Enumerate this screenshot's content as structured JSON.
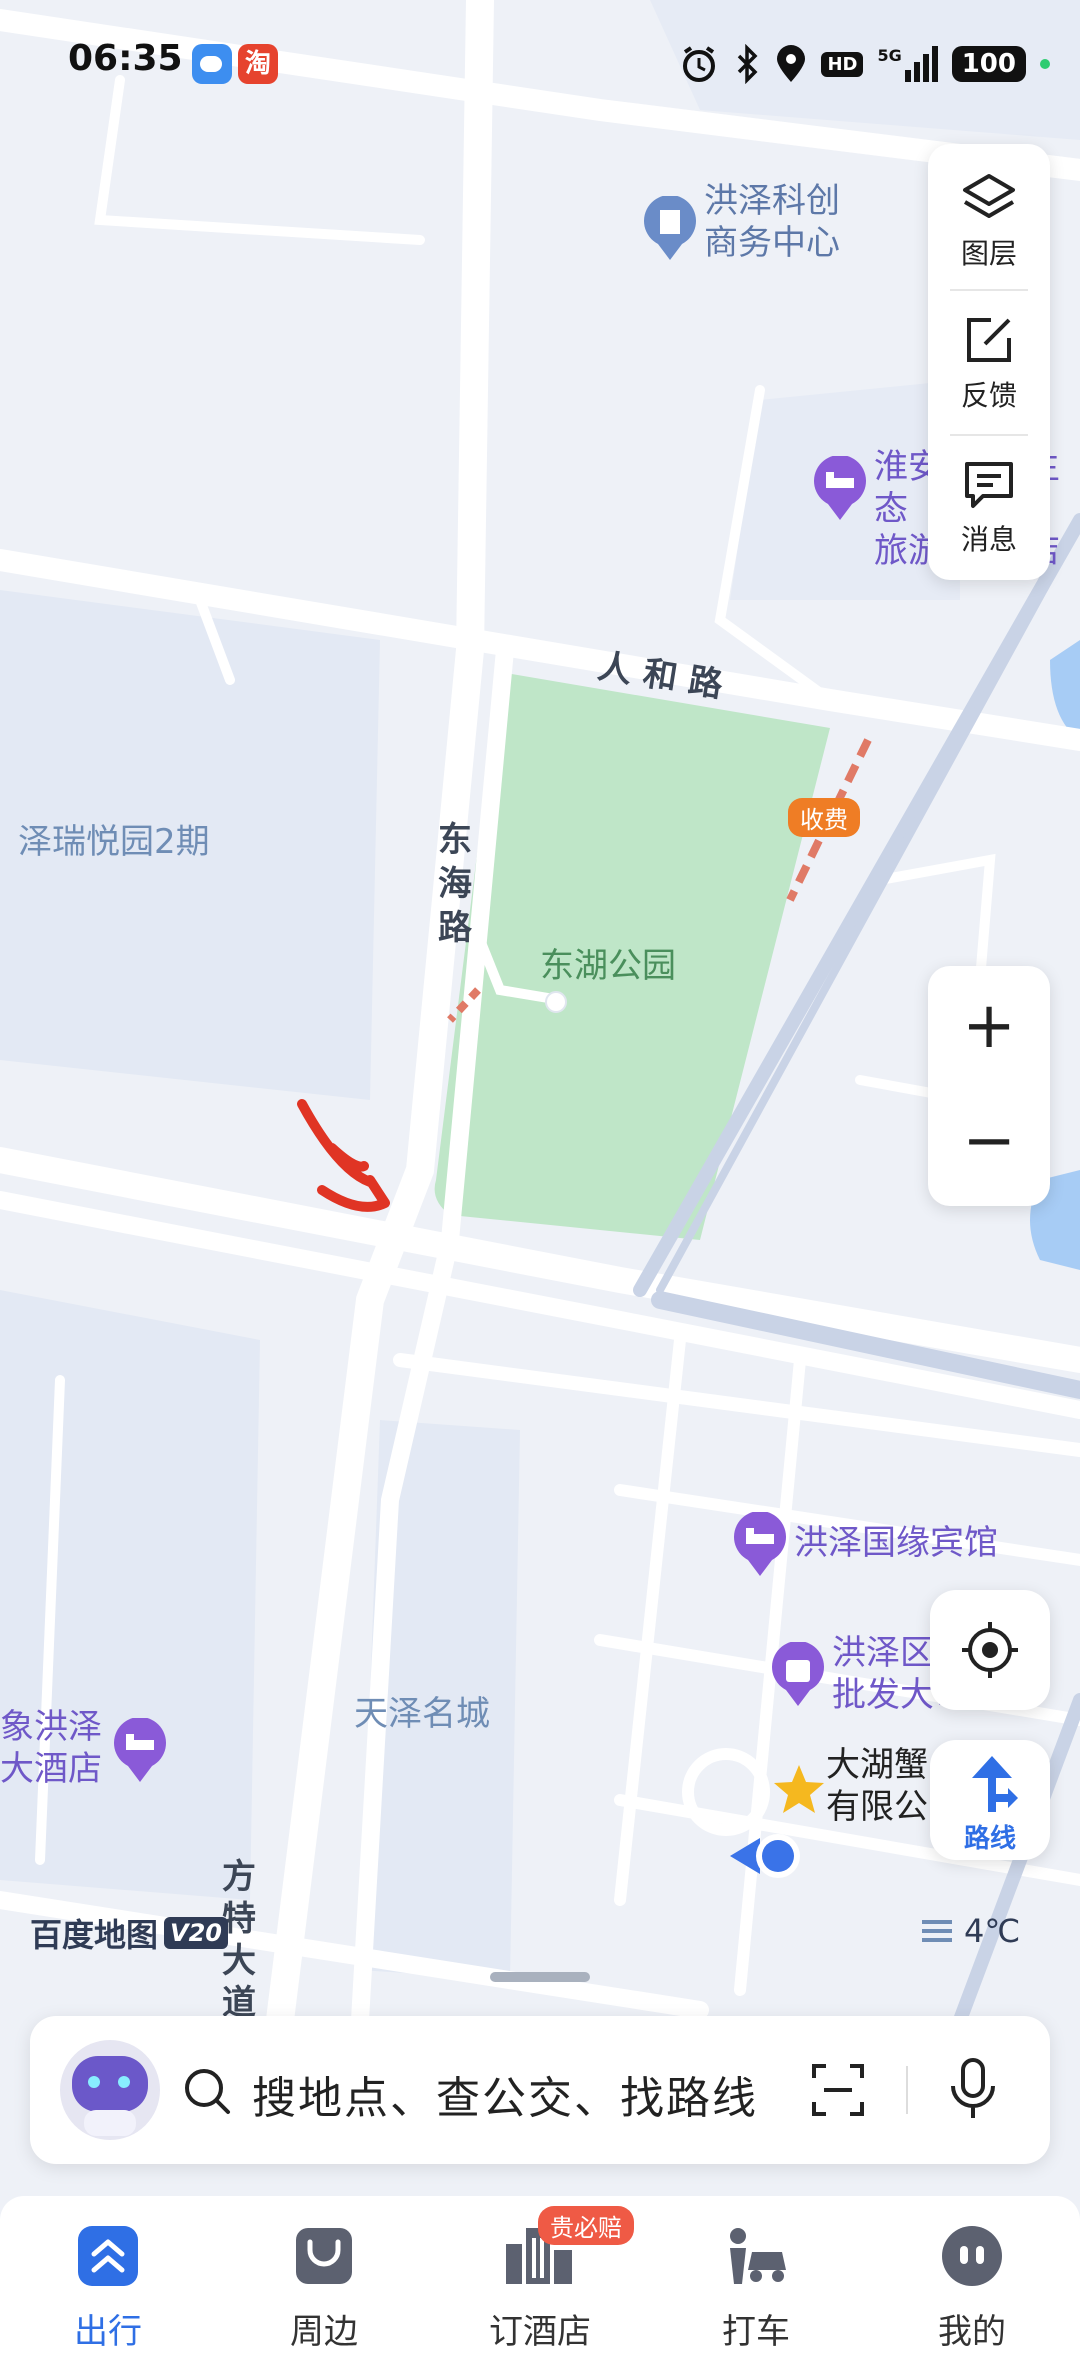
{
  "status_bar": {
    "time": "06:35",
    "icons": [
      "weather-app-icon",
      "taobao-app-icon",
      "alarm-icon",
      "bluetooth-icon",
      "location-icon",
      "hd-icon",
      "5g-signal-icon",
      "battery-icon"
    ],
    "taobao_glyph": "淘",
    "hd": "HD",
    "network": "5G",
    "battery": "100"
  },
  "tools": {
    "layers": "图层",
    "feedback": "反馈",
    "messages": "消息"
  },
  "zoom": {
    "plus": "+",
    "minus": "−"
  },
  "map": {
    "pois": {
      "hongze_business": [
        "洪泽科创",
        "商务中心"
      ],
      "huaian_eco": [
        "淮安",
        "生态",
        "旅游",
        "店"
      ],
      "guoyuan_hotel": "洪泽国缘宾馆",
      "hongze_wholesale": [
        "洪泽区",
        "批发大市"
      ],
      "xiang_hotel": [
        "象洪泽",
        "大酒店"
      ],
      "dahu_crab": [
        "大湖蟹",
        "有限公"
      ]
    },
    "roads": {
      "renhe": "人 和 路",
      "donghai": [
        "东",
        "海",
        "路"
      ],
      "fangte": [
        "方",
        "特",
        "大",
        "道"
      ]
    },
    "areas": {
      "zerui": "泽瑞悦园2期",
      "tianze": "天泽名城",
      "park": "东湖公园"
    },
    "toll": "收费",
    "weather": "4℃",
    "brand": "百度地图",
    "version": "V20"
  },
  "locate": {
    "route": "路线"
  },
  "search": {
    "placeholder": "搜地点、查公交、找路线"
  },
  "bottom_nav": {
    "badge": "贵必赔",
    "items": [
      {
        "label": "出行",
        "active": true
      },
      {
        "label": "周边",
        "active": false
      },
      {
        "label": "订酒店",
        "active": false
      },
      {
        "label": "打车",
        "active": false
      },
      {
        "label": "我的",
        "active": false
      }
    ]
  },
  "colors": {
    "accent": "#2f6fe5",
    "park": "#bfe6c8",
    "poi": "#7f5bd6",
    "annotation": "#e03424"
  }
}
